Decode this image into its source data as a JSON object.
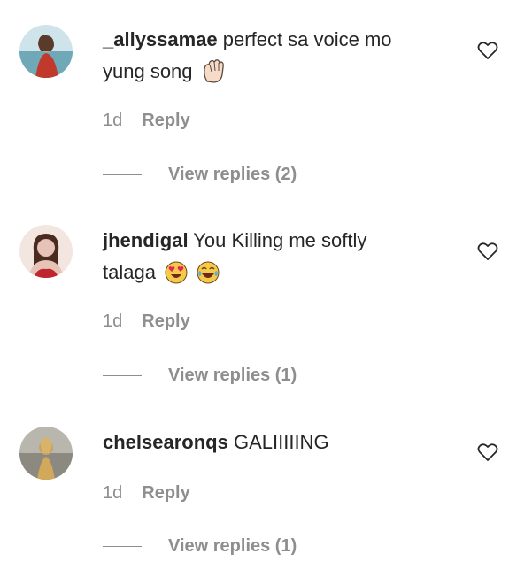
{
  "comments": [
    {
      "username": "_allyssamae",
      "text_line1": "perfect sa voice mo",
      "text_line2": "yung song",
      "emojis": [
        "waving-hand-emoji"
      ],
      "age": "1d",
      "reply_label": "Reply",
      "view_replies": "View replies (2)"
    },
    {
      "username": "jhendigal",
      "text_line1": "You Killing me softly",
      "text_line2": "talaga",
      "emojis": [
        "heart-eyes-emoji",
        "tears-of-joy-emoji"
      ],
      "age": "1d",
      "reply_label": "Reply",
      "view_replies": "View replies (1)"
    },
    {
      "username": "chelsearonqs",
      "text_line1": "GALIIIIING",
      "text_line2": "",
      "emojis": [],
      "age": "1d",
      "reply_label": "Reply",
      "view_replies": "View replies (1)"
    }
  ],
  "colors": {
    "text": "#262626",
    "secondary": "#8e8e8e",
    "avatar1": "#6fa9b8",
    "avatar2": "#e7c2b7",
    "avatar3": "#a89e8e"
  }
}
